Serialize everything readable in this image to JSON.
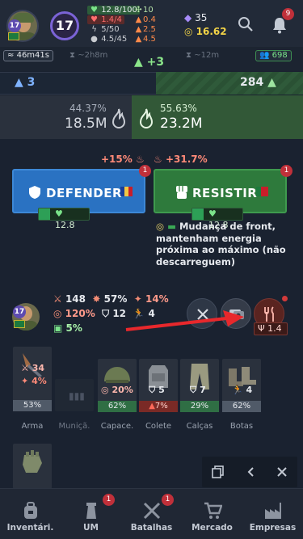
{
  "header": {
    "avatar_level": "17",
    "level": "17",
    "hp": "12.8/100",
    "hp_loss": "1.4/4",
    "energy": "5/50",
    "luck": "4.5/45",
    "r1": "10",
    "r2": "0.4",
    "r3": "2.5",
    "r4": "4.5",
    "gems": "35",
    "gold": "16.62",
    "notifications": "9"
  },
  "strip": {
    "timer": "46m41s",
    "ghost_left": "~2h8m",
    "ghost_right": "~12m",
    "people": "698",
    "plus": "+3"
  },
  "battle": {
    "left_value": "3",
    "right_value": "284",
    "left_pct": "44.37%",
    "left_dmg": "18.5M",
    "right_pct": "55.63%",
    "right_dmg": "23.2M",
    "boost_left": "+15%",
    "boost_right": "+31.7%",
    "defend_label": "DEFENDER",
    "resist_label": "RESISTIR",
    "defend_badge": "1",
    "resist_badge": "1",
    "defend_hp": "12.8",
    "resist_hp": "12.8",
    "note": "Mudança de front, mantenham energia próxima ao máximo (não descarreguem)"
  },
  "player": {
    "level": "17",
    "attack": "148",
    "crit": "57%",
    "crit_dmg": "14%",
    "precision": "120%",
    "armor": "12",
    "dodge": "4",
    "loot": "5%",
    "food_value": "1.4"
  },
  "equipment": [
    {
      "label": "Arma",
      "pct": "53%",
      "stat1": "34",
      "stat2": "4%"
    },
    {
      "label": "Muniçã.",
      "pct": "",
      "stat1": "",
      "stat2": ""
    },
    {
      "label": "Capace.",
      "pct": "62%",
      "stat1": "20%",
      "stat2": ""
    },
    {
      "label": "Colete",
      "pct": "7%",
      "stat1": "5",
      "stat2": ""
    },
    {
      "label": "Calças",
      "pct": "29%",
      "stat1": "7",
      "stat2": ""
    },
    {
      "label": "Botas",
      "pct": "62%",
      "stat1": "4",
      "stat2": ""
    }
  ],
  "nav": [
    {
      "label": "Inventári.",
      "badge": ""
    },
    {
      "label": "UM",
      "badge": "1"
    },
    {
      "label": "Batalhas",
      "badge": "1"
    },
    {
      "label": "Mercado",
      "badge": ""
    },
    {
      "label": "Empresas",
      "badge": ""
    }
  ],
  "colors": {
    "defend": "#2a72c2",
    "resist": "#2e7a3c",
    "accent_red": "#d23a3a",
    "gold": "#f2d347"
  }
}
